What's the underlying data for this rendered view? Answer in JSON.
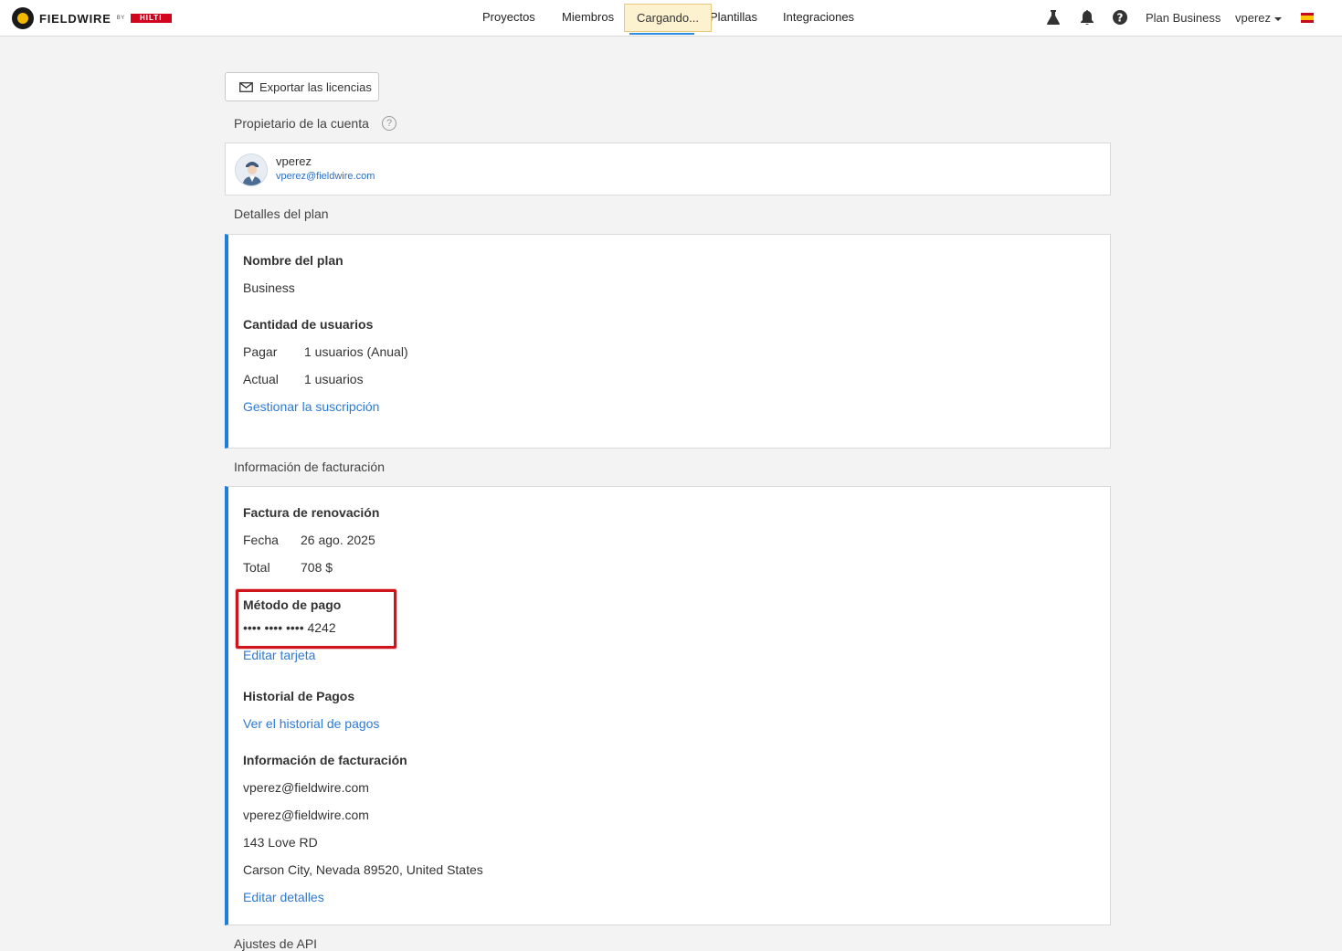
{
  "brand": {
    "name": "FIELDWIRE",
    "by": "BY",
    "partner": "HILTI"
  },
  "nav": {
    "projects": "Proyectos",
    "members": "Miembros",
    "loading": "Cargando...",
    "templates": "Plantillas",
    "integrations": "Integraciones"
  },
  "header_right": {
    "plan": "Plan Business",
    "user": "vperez"
  },
  "actions": {
    "export_label": "Exportar las licencias"
  },
  "owner": {
    "section_title": "Propietario de la cuenta",
    "help": "?",
    "username": "vperez",
    "email": "vperez@fieldwire.com"
  },
  "plan": {
    "section_title": "Detalles del plan",
    "name_label": "Nombre del plan",
    "name_value": "Business",
    "users_label": "Cantidad de usuarios",
    "pay_label": "Pagar",
    "pay_value": "1 usuarios (Anual)",
    "current_label": "Actual",
    "current_value": "1 usuarios",
    "manage_link": "Gestionar la suscripción"
  },
  "billing": {
    "section_title": "Información de facturación",
    "renewal_label": "Factura de renovación",
    "date_label": "Fecha",
    "date_value": "26 ago. 2025",
    "total_label": "Total",
    "total_value": "708 $",
    "payment_label": "Método de pago",
    "card_masked": "•••• •••• •••• 4242",
    "edit_card_link": "Editar tarjeta",
    "history_label": "Historial de Pagos",
    "history_link": "Ver el historial de pagos",
    "info_label": "Información de facturación",
    "email_1": "vperez@fieldwire.com",
    "email_2": "vperez@fieldwire.com",
    "address_1": "143 Love RD",
    "address_2": "Carson City, Nevada 89520, United States",
    "edit_details_link": "Editar detalles"
  },
  "api": {
    "section_title": "Ajustes de API"
  },
  "icons": {
    "lab": "flask-icon",
    "notifications": "bell-icon",
    "help": "question-icon",
    "export": "envelope-icon",
    "language": "spain-flag-icon"
  },
  "colors": {
    "accent": "#1e7fd8",
    "link": "#2d7ad6",
    "highlight": "#d0141c",
    "loading_bg": "#fdf2cf",
    "brand_red": "#d2051e"
  }
}
